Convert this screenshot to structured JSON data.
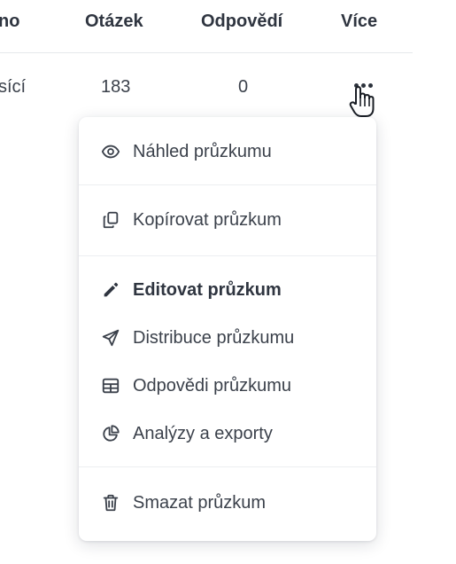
{
  "table": {
    "headers": {
      "name": "no",
      "questions": "Otázek",
      "answers": "Odpovědí",
      "more": "Více"
    },
    "row": {
      "name": "sící",
      "questions": "183",
      "answers": "0"
    }
  },
  "menu": {
    "preview": "Náhled průzkumu",
    "copy": "Kopírovat průzkum",
    "edit": "Editovat průzkum",
    "distribute": "Distribuce průzkumu",
    "responses": "Odpovědi průzkumu",
    "analytics": "Analýzy a exporty",
    "delete": "Smazat průzkum"
  },
  "icons": {
    "preview": "eye-icon",
    "copy": "copy-icon",
    "edit": "pencil-icon",
    "distribute": "paper-plane-icon",
    "responses": "table-icon",
    "analytics": "pie-chart-icon",
    "delete": "trash-icon"
  }
}
